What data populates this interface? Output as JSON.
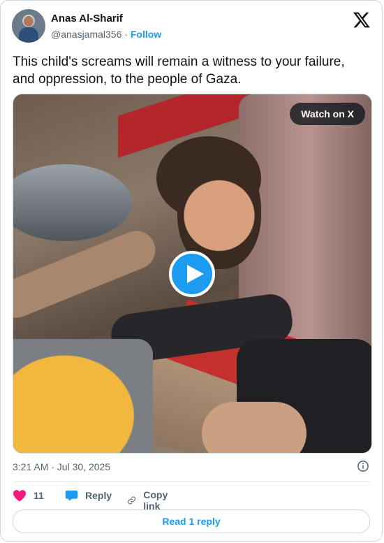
{
  "author": {
    "name": "Anas Al-Sharif",
    "handle": "@anasjamal356",
    "separator": "·",
    "follow_label": "Follow"
  },
  "tweet": {
    "text": "This child's screams will remain a witness to your failure, and oppression, to the people of Gaza."
  },
  "media": {
    "watch_label": "Watch on X"
  },
  "meta": {
    "timestamp": "3:21 AM · Jul 30, 2025"
  },
  "actions": {
    "like_count": "11",
    "reply_label": "Reply",
    "copy_label": "Copy link"
  },
  "footer": {
    "read_replies_label": "Read 1 reply"
  },
  "colors": {
    "accent": "#1d9bf0",
    "like": "#f91880",
    "text": "#0f1419",
    "muted": "#536471"
  },
  "icons": [
    "x-logo-icon",
    "play-icon",
    "info-icon",
    "heart-icon",
    "reply-icon",
    "copy-link-icon"
  ]
}
